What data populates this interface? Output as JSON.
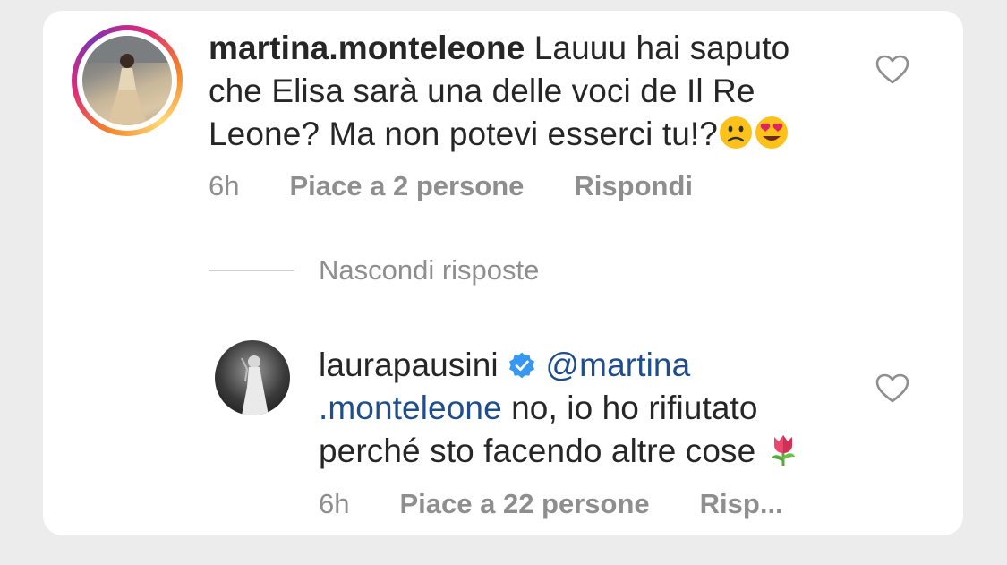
{
  "comment": {
    "username": "martina.monteleone",
    "text_line1": " Lauuu hai saputo",
    "text_line2": "che Elisa sarà una delle voci de Il Re",
    "text_line3": "Leone? Ma non potevi esserci tu!?",
    "time": "6h",
    "likes": "Piace a 2 persone",
    "reply": "Rispondi"
  },
  "thread": {
    "hide_replies": "Nascondi risposte"
  },
  "reply": {
    "username": "laurapausini",
    "mention_line1": "@martina",
    "mention_line2": ".monteleone",
    "text_line2": " no, io ho rifiutato",
    "text_line3": "perché sto facendo altre cose",
    "time": "6h",
    "likes": "Piace a 22 persone",
    "reply": "Risp..."
  },
  "colors": {
    "mention": "#1f4e8c",
    "verified": "#3897f0",
    "meta": "#8e8e8e"
  },
  "icons": [
    "heart-icon",
    "verified-badge-icon",
    "confused-face-emoji",
    "heart-eyes-emoji",
    "tulip-emoji"
  ]
}
